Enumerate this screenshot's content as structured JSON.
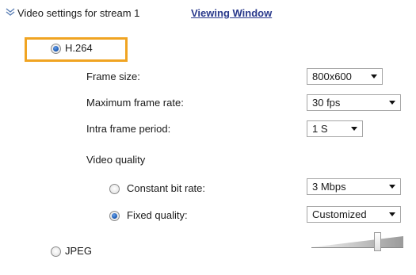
{
  "section": {
    "title": "Video settings for stream 1",
    "viewing_window_link": "Viewing Window"
  },
  "codec": {
    "h264_label": "H.264",
    "h264_selected": true,
    "jpeg_label": "JPEG",
    "jpeg_selected": false,
    "highlight_color": "#f0a422"
  },
  "settings": {
    "frame_size": {
      "label": "Frame size:",
      "value": "800x600"
    },
    "max_frame_rate": {
      "label": "Maximum frame rate:",
      "value": "30 fps"
    },
    "intra_frame_period": {
      "label": "Intra frame period:",
      "value": "1 S"
    },
    "video_quality_label": "Video quality",
    "constant_bit_rate": {
      "label": "Constant bit rate:",
      "value": "3 Mbps",
      "selected": false
    },
    "fixed_quality": {
      "label": "Fixed quality:",
      "value": "Customized",
      "selected": true
    },
    "quality_slider_level": 0.75
  },
  "icons": {
    "section_toggle": "double-chevron-down-icon"
  },
  "colors": {
    "link": "#2a3a8c",
    "radio_selected": "#1f5fb8"
  }
}
